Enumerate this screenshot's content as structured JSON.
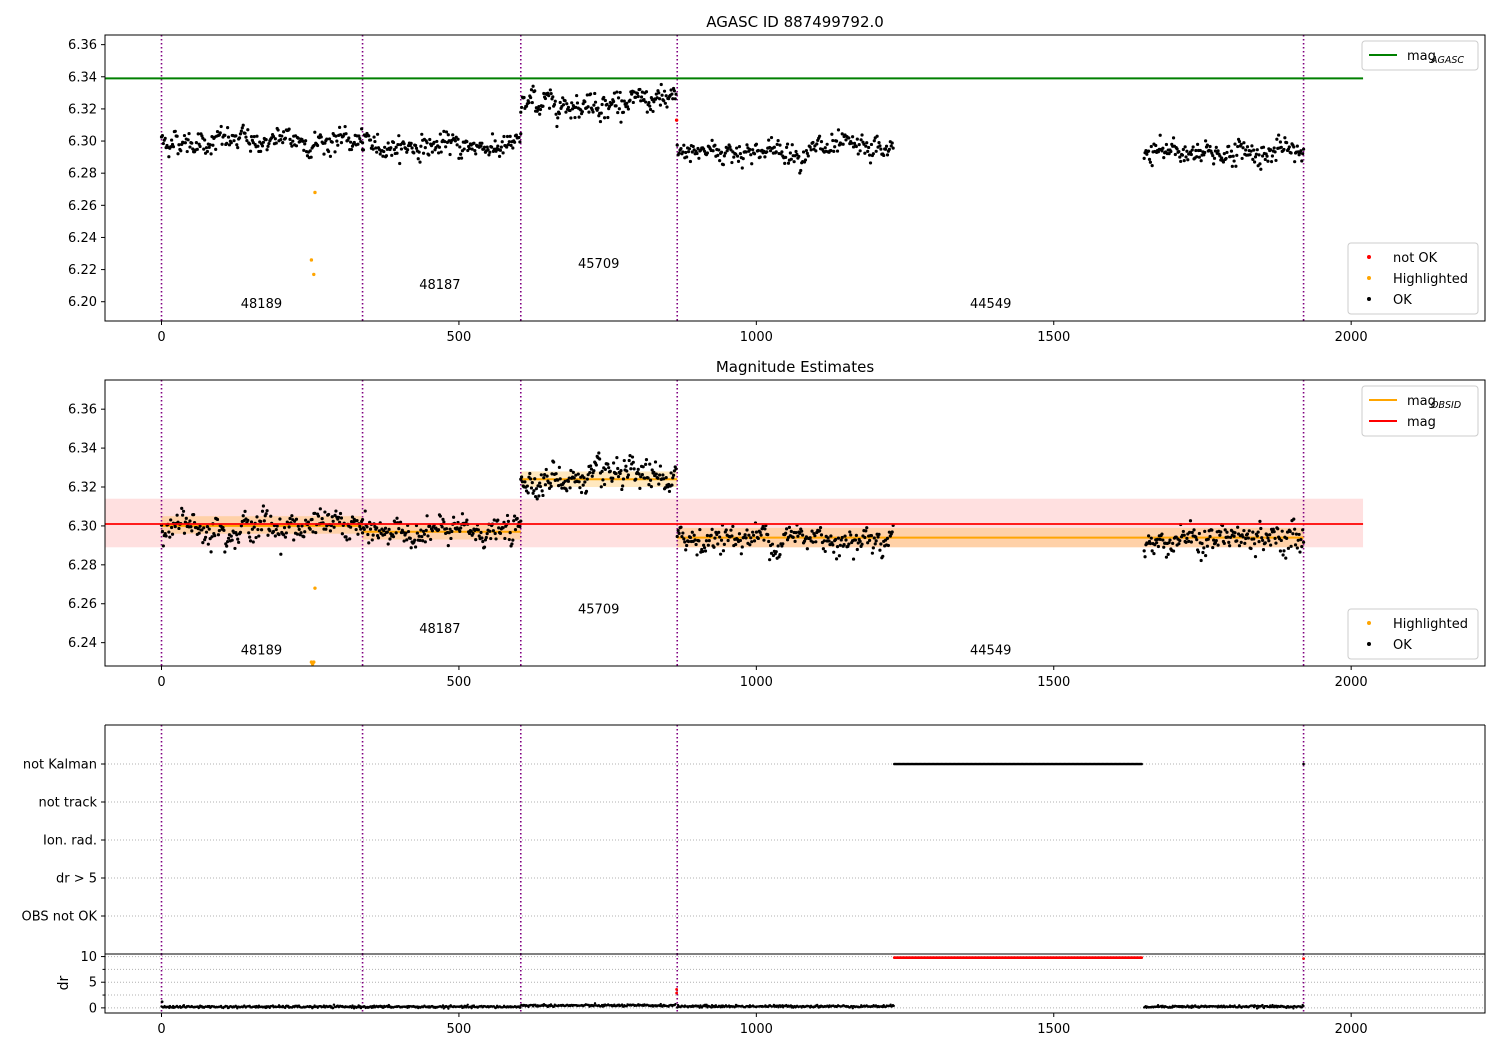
{
  "figure": {
    "background": "#ffffff"
  },
  "chart_data": [
    {
      "id": "panel1",
      "type": "scatter",
      "title": "AGASC ID 887499792.0",
      "xlabel": "",
      "ylabel": "",
      "xlim": [
        -95,
        2225
      ],
      "ylim": [
        6.188,
        6.366
      ],
      "xticks": [
        0,
        500,
        1000,
        1500,
        2000
      ],
      "xtick_labels": [
        "0",
        "500",
        "1000",
        "1500",
        "2000"
      ],
      "yticks": [
        6.2,
        6.22,
        6.24,
        6.26,
        6.28,
        6.3,
        6.32,
        6.34,
        6.36
      ],
      "ytick_labels": [
        "6.20",
        "6.22",
        "6.24",
        "6.26",
        "6.28",
        "6.30",
        "6.32",
        "6.34",
        "6.36"
      ],
      "grid": false,
      "obsid_boundaries": [
        0,
        338,
        604,
        867,
        1920
      ],
      "obsid_labels": [
        {
          "text": "48189",
          "x": 168,
          "y": 6.196
        },
        {
          "text": "48187",
          "x": 468,
          "y": 6.208
        },
        {
          "text": "45709",
          "x": 735,
          "y": 6.221
        },
        {
          "text": "44549",
          "x": 1394,
          "y": 6.196
        }
      ],
      "lines": [
        {
          "name": "mag_AGASC",
          "color": "#008000",
          "x": [
            -95,
            2020
          ],
          "y": [
            6.339,
            6.339
          ]
        }
      ],
      "point_series": [
        {
          "name": "OK",
          "color": "#000000",
          "segments": [
            {
              "x_start": 0,
              "x_end": 338,
              "n": 220,
              "mean": 6.3,
              "sd": 0.0045
            },
            {
              "x_start": 338,
              "x_end": 604,
              "n": 180,
              "mean": 6.297,
              "sd": 0.004
            },
            {
              "x_start": 604,
              "x_end": 865,
              "n": 190,
              "mean": 6.324,
              "sd": 0.0045
            },
            {
              "x_start": 867,
              "x_end": 1230,
              "n": 230,
              "mean": 6.294,
              "sd": 0.0045
            },
            {
              "x_start": 1652,
              "x_end": 1920,
              "n": 180,
              "mean": 6.293,
              "sd": 0.0045
            }
          ]
        },
        {
          "name": "Highlighted",
          "color": "#ffa500",
          "points": [
            [
              258,
              6.268
            ],
            [
              252,
              6.226
            ],
            [
              256,
              6.217
            ]
          ]
        },
        {
          "name": "not OK",
          "color": "#ff0000",
          "points": [
            [
              866,
              6.313
            ]
          ]
        }
      ],
      "legends": [
        {
          "placement": "upper-right",
          "entries": [
            {
              "label": "mag",
              "sub": "AGASC",
              "kind": "line",
              "color": "#008000"
            }
          ]
        },
        {
          "placement": "lower-right",
          "entries": [
            {
              "label": "not OK",
              "kind": "dot",
              "color": "#ff0000"
            },
            {
              "label": "Highlighted",
              "kind": "dot",
              "color": "#ffa500"
            },
            {
              "label": "OK",
              "kind": "dot",
              "color": "#000000"
            }
          ]
        }
      ]
    },
    {
      "id": "panel2",
      "type": "scatter",
      "title": "Magnitude Estimates",
      "xlabel": "",
      "ylabel": "",
      "xlim": [
        -95,
        2225
      ],
      "ylim": [
        6.228,
        6.375
      ],
      "xticks": [
        0,
        500,
        1000,
        1500,
        2000
      ],
      "xtick_labels": [
        "0",
        "500",
        "1000",
        "1500",
        "2000"
      ],
      "yticks": [
        6.24,
        6.26,
        6.28,
        6.3,
        6.32,
        6.34,
        6.36
      ],
      "ytick_labels": [
        "6.24",
        "6.26",
        "6.28",
        "6.30",
        "6.32",
        "6.34",
        "6.36"
      ],
      "grid": false,
      "obsid_boundaries": [
        0,
        338,
        604,
        867,
        1920
      ],
      "obsid_labels": [
        {
          "text": "48189",
          "x": 168,
          "y": 6.234
        },
        {
          "text": "48187",
          "x": 468,
          "y": 6.245
        },
        {
          "text": "45709",
          "x": 735,
          "y": 6.255
        },
        {
          "text": "44549",
          "x": 1394,
          "y": 6.234
        }
      ],
      "bands": [
        {
          "name": "mag band",
          "color": "#ff0000",
          "opacity": 0.12,
          "x": [
            -95,
            2020
          ],
          "y": [
            6.289,
            6.314
          ]
        },
        {
          "name": "obsid 48189 band",
          "color": "#ffa500",
          "opacity": 0.25,
          "x": [
            0,
            338
          ],
          "y": [
            6.296,
            6.305
          ]
        },
        {
          "name": "obsid 48187 band",
          "color": "#ffa500",
          "opacity": 0.25,
          "x": [
            338,
            604
          ],
          "y": [
            6.293,
            6.301
          ]
        },
        {
          "name": "obsid 45709 band",
          "color": "#ffa500",
          "opacity": 0.25,
          "x": [
            604,
            867
          ],
          "y": [
            6.32,
            6.328
          ]
        },
        {
          "name": "obsid 44549 band",
          "color": "#ffa500",
          "opacity": 0.25,
          "x": [
            867,
            1920
          ],
          "y": [
            6.289,
            6.299
          ]
        }
      ],
      "lines": [
        {
          "name": "mag_OBSID 48189",
          "color": "#ffa500",
          "x": [
            0,
            338
          ],
          "y": [
            6.3,
            6.3
          ]
        },
        {
          "name": "mag_OBSID 48187",
          "color": "#ffa500",
          "x": [
            338,
            604
          ],
          "y": [
            6.297,
            6.297
          ]
        },
        {
          "name": "mag_OBSID 45709",
          "color": "#ffa500",
          "x": [
            604,
            867
          ],
          "y": [
            6.324,
            6.324
          ]
        },
        {
          "name": "mag_OBSID 44549",
          "color": "#ffa500",
          "x": [
            867,
            1920
          ],
          "y": [
            6.294,
            6.294
          ]
        },
        {
          "name": "mag",
          "color": "#ff0000",
          "x": [
            -95,
            2020
          ],
          "y": [
            6.301,
            6.301
          ]
        }
      ],
      "point_series": [
        {
          "name": "OK",
          "color": "#000000",
          "segments": [
            {
              "x_start": 0,
              "x_end": 338,
              "n": 220,
              "mean": 6.3,
              "sd": 0.0045
            },
            {
              "x_start": 338,
              "x_end": 604,
              "n": 180,
              "mean": 6.297,
              "sd": 0.004
            },
            {
              "x_start": 604,
              "x_end": 865,
              "n": 190,
              "mean": 6.324,
              "sd": 0.0045
            },
            {
              "x_start": 867,
              "x_end": 1230,
              "n": 230,
              "mean": 6.294,
              "sd": 0.0045
            },
            {
              "x_start": 1652,
              "x_end": 1920,
              "n": 180,
              "mean": 6.293,
              "sd": 0.0045
            }
          ]
        },
        {
          "name": "Highlighted",
          "color": "#ffa500",
          "points": [
            [
              258,
              6.268
            ],
            [
              252,
              6.23
            ],
            [
              254,
              6.229
            ],
            [
              256,
              6.23
            ]
          ]
        }
      ],
      "legends": [
        {
          "placement": "upper-right",
          "entries": [
            {
              "label": "mag",
              "sub": "OBSID",
              "kind": "line",
              "color": "#ffa500"
            },
            {
              "label": "mag",
              "sub": "",
              "kind": "line",
              "color": "#ff0000"
            }
          ]
        },
        {
          "placement": "lower-right",
          "entries": [
            {
              "label": "Highlighted",
              "kind": "dot",
              "color": "#ffa500"
            },
            {
              "label": "OK",
              "kind": "dot",
              "color": "#000000"
            }
          ]
        }
      ]
    },
    {
      "id": "panel3",
      "type": "scatter",
      "title": "",
      "xlabel": "",
      "ylabel": "",
      "xlim": [
        -95,
        2225
      ],
      "categories": [
        "OBS not OK",
        "dr > 5",
        "Ion. rad.",
        "not track",
        "not Kalman"
      ],
      "grid": "horizontal-dotted",
      "obsid_boundaries": [
        0,
        338,
        604,
        867,
        1920
      ],
      "flag_runs": [
        {
          "category": "not Kalman",
          "x_start": 1232,
          "x_end": 1650,
          "color": "#000000"
        }
      ],
      "flag_points": [
        {
          "category": "not Kalman",
          "x": 1920,
          "color": "#000000"
        }
      ]
    },
    {
      "id": "panel4",
      "type": "scatter",
      "title": "",
      "xlabel": "",
      "ylabel": "dr",
      "xlim": [
        -95,
        2225
      ],
      "ylim": [
        -1,
        10.5
      ],
      "xticks": [
        0,
        500,
        1000,
        1500,
        2000
      ],
      "xtick_labels": [
        "0",
        "500",
        "1000",
        "1500",
        "2000"
      ],
      "yticks": [
        0,
        5,
        10
      ],
      "ytick_labels": [
        "0",
        "5",
        "10"
      ],
      "minor_yticks": [
        2.5,
        7.5
      ],
      "grid": "horizontal-dotted",
      "obsid_boundaries": [
        0,
        338,
        604,
        867,
        1920
      ],
      "dr_segments": [
        {
          "x_start": 0,
          "x_end": 338,
          "value": 0.2,
          "color": "#000000"
        },
        {
          "x_start": 338,
          "x_end": 604,
          "value": 0.2,
          "color": "#000000"
        },
        {
          "x_start": 604,
          "x_end": 865,
          "value": 0.45,
          "color": "#000000"
        },
        {
          "x_start": 867,
          "x_end": 1232,
          "value": 0.3,
          "color": "#000000"
        },
        {
          "x_start": 1652,
          "x_end": 1920,
          "value": 0.25,
          "color": "#000000"
        }
      ],
      "dr_capped": {
        "x_start": 1232,
        "x_end": 1650,
        "value": 9.8,
        "color": "#ff0000"
      },
      "dr_points": [
        {
          "x": 866,
          "y": 3.6,
          "color": "#ff0000"
        },
        {
          "x": 866,
          "y": 2.9,
          "color": "#ff0000"
        },
        {
          "x": 1920,
          "y": 9.6,
          "color": "#ff0000"
        },
        {
          "x": 1,
          "y": 1.2,
          "color": "#000000"
        }
      ]
    }
  ]
}
